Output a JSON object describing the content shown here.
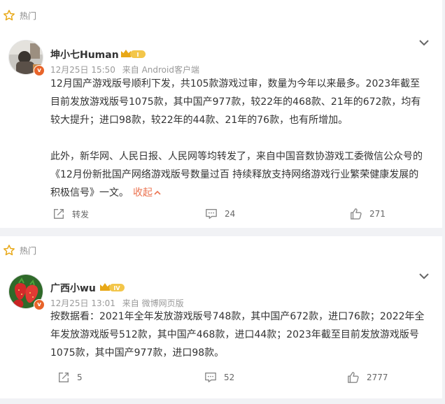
{
  "posts": [
    {
      "hot_label": "热门",
      "author": "坤小七Human",
      "level_badge": "I",
      "date": "12月25日 15:50",
      "source": "来自 Android客户端",
      "paragraphs": [
        "12月国产游戏版号顺利下发，共105款游戏过审，数量为今年以来最多。2023年截至目前发放游戏版号1075款，其中国产977款，较22年的468款、21年的672款，均有较大提升；进口98款，较22年的44款、21年的76款，也有所增加。",
        "此外，新华网、人民日报、人民网等均转发了，来自中国音数协游戏工委微信公众号的《12月份新批国产网络游戏版号数量过百 持续释放支持网络游戏行业繁荣健康发展的积极信号》一文。"
      ],
      "fold_label": "收起",
      "repost": "转发",
      "comments": "24",
      "likes": "271"
    },
    {
      "hot_label": "热门",
      "author": "广西小wu",
      "level_badge": "IV",
      "date": "12月25日 13:01",
      "source": "来自 微博网页版",
      "paragraphs": [
        "按数据看：2021年全年发放游戏版号748款，其中国产672款，进口76款；2022年全年发放游戏版号512款，其中国产468款，进口44款；2023年截至目前发放游戏版号1075款，其中国产977款，进口98款。"
      ],
      "repost": "5",
      "comments": "52",
      "likes": "2777"
    }
  ],
  "colors": {
    "accent": "#eb7350",
    "crown": "#e8a817",
    "vbadge": "#e8642a"
  },
  "icons": [
    "star-icon",
    "chevron-down-icon",
    "repost-icon",
    "comment-icon",
    "like-icon",
    "caret-up-icon"
  ]
}
